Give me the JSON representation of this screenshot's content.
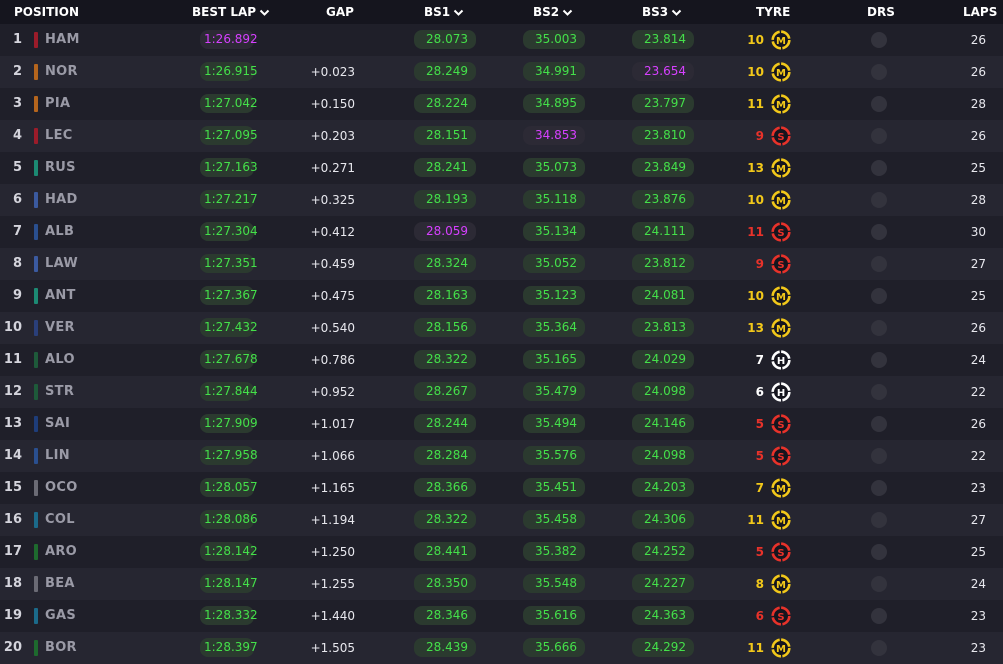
{
  "header": {
    "position": "POSITION",
    "best_lap": "BEST LAP",
    "gap": "GAP",
    "bs1": "BS1",
    "bs2": "BS2",
    "bs3": "BS3",
    "tyre": "TYRE",
    "drs": "DRS",
    "laps": "LAPS"
  },
  "colors": {
    "sector_green": "#44e04a",
    "sector_purple": "#d640ff",
    "medium": "#f2c81a",
    "soft": "#e8322a",
    "hard": "#ffffff"
  },
  "compounds": {
    "M": {
      "letter": "M",
      "color": "#f2c81a"
    },
    "S": {
      "letter": "S",
      "color": "#e8322a"
    },
    "H": {
      "letter": "H",
      "color": "#ffffff"
    }
  },
  "drivers": [
    {
      "pos": "1",
      "code": "HAM",
      "team_color": "#9b1c2a",
      "best_lap": "1:26.892",
      "best_lap_purple": true,
      "gap": "",
      "bs1": "28.073",
      "bs1_purple": false,
      "bs2": "35.003",
      "bs2_purple": false,
      "bs3": "23.814",
      "bs3_purple": false,
      "tyre_age": "10",
      "tyre": "M",
      "laps": "26"
    },
    {
      "pos": "2",
      "code": "NOR",
      "team_color": "#b5651d",
      "best_lap": "1:26.915",
      "best_lap_purple": false,
      "gap": "+0.023",
      "bs1": "28.249",
      "bs1_purple": false,
      "bs2": "34.991",
      "bs2_purple": false,
      "bs3": "23.654",
      "bs3_purple": true,
      "tyre_age": "10",
      "tyre": "M",
      "laps": "26"
    },
    {
      "pos": "3",
      "code": "PIA",
      "team_color": "#b5651d",
      "best_lap": "1:27.042",
      "best_lap_purple": false,
      "gap": "+0.150",
      "bs1": "28.224",
      "bs1_purple": false,
      "bs2": "34.895",
      "bs2_purple": false,
      "bs3": "23.797",
      "bs3_purple": false,
      "tyre_age": "11",
      "tyre": "M",
      "laps": "28"
    },
    {
      "pos": "4",
      "code": "LEC",
      "team_color": "#9b1c2a",
      "best_lap": "1:27.095",
      "best_lap_purple": false,
      "gap": "+0.203",
      "bs1": "28.151",
      "bs1_purple": false,
      "bs2": "34.853",
      "bs2_purple": true,
      "bs3": "23.810",
      "bs3_purple": false,
      "tyre_age": "9",
      "tyre": "S",
      "laps": "26"
    },
    {
      "pos": "5",
      "code": "RUS",
      "team_color": "#1c8a73",
      "best_lap": "1:27.163",
      "best_lap_purple": false,
      "gap": "+0.271",
      "bs1": "28.241",
      "bs1_purple": false,
      "bs2": "35.073",
      "bs2_purple": false,
      "bs3": "23.849",
      "bs3_purple": false,
      "tyre_age": "13",
      "tyre": "M",
      "laps": "25"
    },
    {
      "pos": "6",
      "code": "HAD",
      "team_color": "#3b5aa0",
      "best_lap": "1:27.217",
      "best_lap_purple": false,
      "gap": "+0.325",
      "bs1": "28.193",
      "bs1_purple": false,
      "bs2": "35.118",
      "bs2_purple": false,
      "bs3": "23.876",
      "bs3_purple": false,
      "tyre_age": "10",
      "tyre": "M",
      "laps": "28"
    },
    {
      "pos": "7",
      "code": "ALB",
      "team_color": "#2a4f8f",
      "best_lap": "1:27.304",
      "best_lap_purple": false,
      "gap": "+0.412",
      "bs1": "28.059",
      "bs1_purple": true,
      "bs2": "35.134",
      "bs2_purple": false,
      "bs3": "24.111",
      "bs3_purple": false,
      "tyre_age": "11",
      "tyre": "S",
      "laps": "30"
    },
    {
      "pos": "8",
      "code": "LAW",
      "team_color": "#3b5aa0",
      "best_lap": "1:27.351",
      "best_lap_purple": false,
      "gap": "+0.459",
      "bs1": "28.324",
      "bs1_purple": false,
      "bs2": "35.052",
      "bs2_purple": false,
      "bs3": "23.812",
      "bs3_purple": false,
      "tyre_age": "9",
      "tyre": "S",
      "laps": "27"
    },
    {
      "pos": "9",
      "code": "ANT",
      "team_color": "#1c8a73",
      "best_lap": "1:27.367",
      "best_lap_purple": false,
      "gap": "+0.475",
      "bs1": "28.163",
      "bs1_purple": false,
      "bs2": "35.123",
      "bs2_purple": false,
      "bs3": "24.081",
      "bs3_purple": false,
      "tyre_age": "10",
      "tyre": "M",
      "laps": "25"
    },
    {
      "pos": "10",
      "code": "VER",
      "team_color": "#2a3f7a",
      "best_lap": "1:27.432",
      "best_lap_purple": false,
      "gap": "+0.540",
      "bs1": "28.156",
      "bs1_purple": false,
      "bs2": "35.364",
      "bs2_purple": false,
      "bs3": "23.813",
      "bs3_purple": false,
      "tyre_age": "13",
      "tyre": "M",
      "laps": "26"
    },
    {
      "pos": "11",
      "code": "ALO",
      "team_color": "#1e5a3a",
      "best_lap": "1:27.678",
      "best_lap_purple": false,
      "gap": "+0.786",
      "bs1": "28.322",
      "bs1_purple": false,
      "bs2": "35.165",
      "bs2_purple": false,
      "bs3": "24.029",
      "bs3_purple": false,
      "tyre_age": "7",
      "tyre": "H",
      "laps": "24"
    },
    {
      "pos": "12",
      "code": "STR",
      "team_color": "#1e5a3a",
      "best_lap": "1:27.844",
      "best_lap_purple": false,
      "gap": "+0.952",
      "bs1": "28.267",
      "bs1_purple": false,
      "bs2": "35.479",
      "bs2_purple": false,
      "bs3": "24.098",
      "bs3_purple": false,
      "tyre_age": "6",
      "tyre": "H",
      "laps": "22"
    },
    {
      "pos": "13",
      "code": "SAI",
      "team_color": "#1e3d7a",
      "best_lap": "1:27.909",
      "best_lap_purple": false,
      "gap": "+1.017",
      "bs1": "28.244",
      "bs1_purple": false,
      "bs2": "35.494",
      "bs2_purple": false,
      "bs3": "24.146",
      "bs3_purple": false,
      "tyre_age": "5",
      "tyre": "S",
      "laps": "26"
    },
    {
      "pos": "14",
      "code": "LIN",
      "team_color": "#2a4f8f",
      "best_lap": "1:27.958",
      "best_lap_purple": false,
      "gap": "+1.066",
      "bs1": "28.284",
      "bs1_purple": false,
      "bs2": "35.576",
      "bs2_purple": false,
      "bs3": "24.098",
      "bs3_purple": false,
      "tyre_age": "5",
      "tyre": "S",
      "laps": "22"
    },
    {
      "pos": "15",
      "code": "OCO",
      "team_color": "#6b6b75",
      "best_lap": "1:28.057",
      "best_lap_purple": false,
      "gap": "+1.165",
      "bs1": "28.366",
      "bs1_purple": false,
      "bs2": "35.451",
      "bs2_purple": false,
      "bs3": "24.203",
      "bs3_purple": false,
      "tyre_age": "7",
      "tyre": "M",
      "laps": "23"
    },
    {
      "pos": "16",
      "code": "COL",
      "team_color": "#1b6a8a",
      "best_lap": "1:28.086",
      "best_lap_purple": false,
      "gap": "+1.194",
      "bs1": "28.322",
      "bs1_purple": false,
      "bs2": "35.458",
      "bs2_purple": false,
      "bs3": "24.306",
      "bs3_purple": false,
      "tyre_age": "11",
      "tyre": "M",
      "laps": "27"
    },
    {
      "pos": "17",
      "code": "ARO",
      "team_color": "#1e6a2e",
      "best_lap": "1:28.142",
      "best_lap_purple": false,
      "gap": "+1.250",
      "bs1": "28.441",
      "bs1_purple": false,
      "bs2": "35.382",
      "bs2_purple": false,
      "bs3": "24.252",
      "bs3_purple": false,
      "tyre_age": "5",
      "tyre": "S",
      "laps": "25"
    },
    {
      "pos": "18",
      "code": "BEA",
      "team_color": "#6b6b75",
      "best_lap": "1:28.147",
      "best_lap_purple": false,
      "gap": "+1.255",
      "bs1": "28.350",
      "bs1_purple": false,
      "bs2": "35.548",
      "bs2_purple": false,
      "bs3": "24.227",
      "bs3_purple": false,
      "tyre_age": "8",
      "tyre": "M",
      "laps": "24"
    },
    {
      "pos": "19",
      "code": "GAS",
      "team_color": "#1b6a8a",
      "best_lap": "1:28.332",
      "best_lap_purple": false,
      "gap": "+1.440",
      "bs1": "28.346",
      "bs1_purple": false,
      "bs2": "35.616",
      "bs2_purple": false,
      "bs3": "24.363",
      "bs3_purple": false,
      "tyre_age": "6",
      "tyre": "S",
      "laps": "23"
    },
    {
      "pos": "20",
      "code": "BOR",
      "team_color": "#1e6a2e",
      "best_lap": "1:28.397",
      "best_lap_purple": false,
      "gap": "+1.505",
      "bs1": "28.439",
      "bs1_purple": false,
      "bs2": "35.666",
      "bs2_purple": false,
      "bs3": "24.292",
      "bs3_purple": false,
      "tyre_age": "11",
      "tyre": "M",
      "laps": "23"
    }
  ]
}
